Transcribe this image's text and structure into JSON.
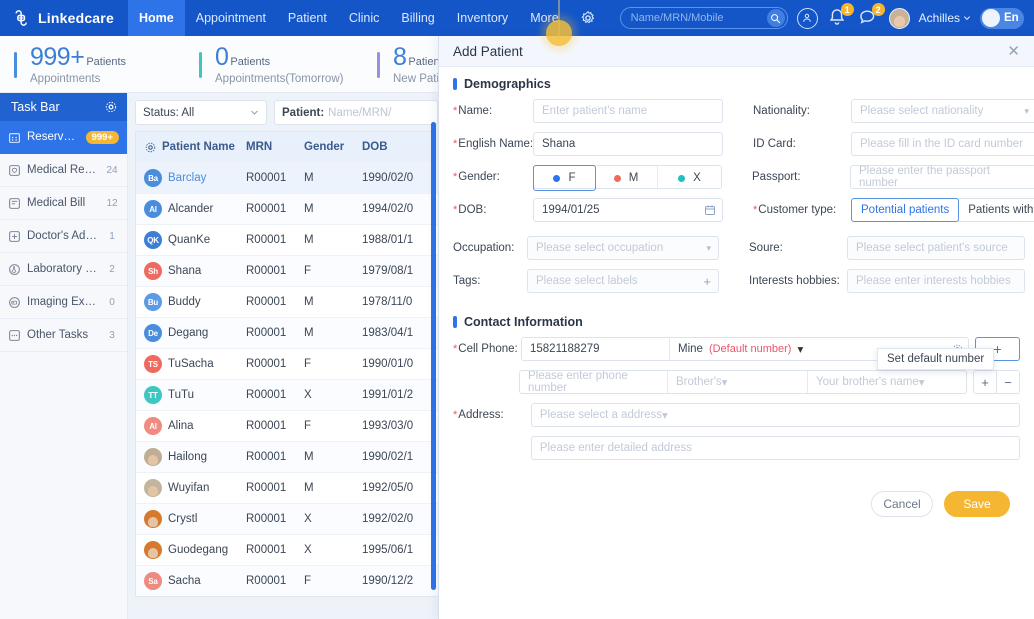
{
  "topnav": {
    "brand": "Linkedcare",
    "items": [
      {
        "label": "Home",
        "active": true
      },
      {
        "label": "Appointment",
        "active": false
      },
      {
        "label": "Patient",
        "active": false
      },
      {
        "label": "Clinic",
        "active": false
      },
      {
        "label": "Billing",
        "active": false
      },
      {
        "label": "Inventory",
        "active": false
      },
      {
        "label": "More",
        "active": false
      }
    ],
    "gear_icon": "gear-icon",
    "search": {
      "placeholder": "Name/MRN/Mobile",
      "value": "",
      "icon": "search-icon"
    },
    "user_add_icon": "user-add-icon",
    "bell": {
      "icon": "bell-icon",
      "badge": "1"
    },
    "chat": {
      "icon": "chat-icon",
      "badge": "2"
    },
    "account": {
      "name": "Achilles",
      "caret": "⌄"
    },
    "language": {
      "label": "En"
    }
  },
  "stats": [
    {
      "number": "999+",
      "unit": "Patients",
      "sub": "Appointments",
      "color": "#4a8ddd"
    },
    {
      "number": "0",
      "unit": "Patients",
      "sub": "Appointments(Tomorrow)",
      "color": "#3ec6c0"
    },
    {
      "number": "8",
      "unit": "Patients",
      "sub": "New Patients",
      "color": "#9a8ede"
    }
  ],
  "sidebar": {
    "title": "Task Bar",
    "gear_icon": "gear-icon",
    "items": [
      {
        "label": "Reservation",
        "count": "999+",
        "pill": true,
        "active": true,
        "icon": "calendar-icon"
      },
      {
        "label": "Medical Record",
        "count": "24",
        "pill": false,
        "active": false,
        "icon": "record-icon"
      },
      {
        "label": "Medical Bill",
        "count": "12",
        "pill": false,
        "active": false,
        "icon": "bill-icon"
      },
      {
        "label": "Doctor's Advice",
        "count": "1",
        "pill": false,
        "active": false,
        "icon": "advice-icon"
      },
      {
        "label": "Laboratory Ex...",
        "count": "2",
        "pill": false,
        "active": false,
        "icon": "lab-icon"
      },
      {
        "label": "Imaging Exam...",
        "count": "0",
        "pill": false,
        "active": false,
        "icon": "imaging-icon"
      },
      {
        "label": "Other Tasks",
        "count": "3",
        "pill": false,
        "active": false,
        "icon": "other-icon"
      }
    ]
  },
  "list": {
    "status_filter": {
      "label": "Status: All"
    },
    "patient_filter": {
      "label": "Patient:",
      "placeholder": "Name/MRN/"
    },
    "columns": [
      "Patient Name",
      "MRN",
      "Gender",
      "DOB"
    ],
    "rows": [
      {
        "initials": "Ba",
        "name": "Barclay",
        "mrn": "R00001",
        "gender": "M",
        "dob": "1990/02/0",
        "color": "#4a8ddd",
        "photo": false,
        "selected": true
      },
      {
        "initials": "Al",
        "name": "Alcander",
        "mrn": "R00001",
        "gender": "M",
        "dob": "1994/02/0",
        "color": "#4a8ddd",
        "photo": false,
        "selected": false
      },
      {
        "initials": "QK",
        "name": "QuanKe",
        "mrn": "R00001",
        "gender": "M",
        "dob": "1988/01/1",
        "color": "#3d7fd6",
        "photo": false,
        "selected": false
      },
      {
        "initials": "Sh",
        "name": "Shana",
        "mrn": "R00001",
        "gender": "F",
        "dob": "1979/08/1",
        "color": "#ef6a5e",
        "photo": false,
        "selected": false
      },
      {
        "initials": "Bu",
        "name": "Buddy",
        "mrn": "R00001",
        "gender": "M",
        "dob": "1978/11/0",
        "color": "#5b9ae6",
        "photo": false,
        "selected": false
      },
      {
        "initials": "De",
        "name": "Degang",
        "mrn": "R00001",
        "gender": "M",
        "dob": "1983/04/1",
        "color": "#4a8ddd",
        "photo": false,
        "selected": false
      },
      {
        "initials": "TS",
        "name": "TuSacha",
        "mrn": "R00001",
        "gender": "F",
        "dob": "1990/01/0",
        "color": "#ef6a5e",
        "photo": false,
        "selected": false
      },
      {
        "initials": "TT",
        "name": "TuTu",
        "mrn": "R00001",
        "gender": "X",
        "dob": "1991/01/2",
        "color": "#3ec6c0",
        "photo": false,
        "selected": false
      },
      {
        "initials": "Al",
        "name": "Alina",
        "mrn": "R00001",
        "gender": "F",
        "dob": "1993/03/0",
        "color": "#f08b82",
        "photo": false,
        "selected": false
      },
      {
        "initials": "",
        "name": "Hailong",
        "mrn": "R00001",
        "gender": "M",
        "dob": "1990/02/1",
        "color": "#c9b49b",
        "photo": true,
        "selected": false
      },
      {
        "initials": "",
        "name": "Wuyifan",
        "mrn": "R00001",
        "gender": "M",
        "dob": "1992/05/0",
        "color": "#c9b49b",
        "photo": true,
        "selected": false
      },
      {
        "initials": "",
        "name": "Crystl",
        "mrn": "R00001",
        "gender": "X",
        "dob": "1992/02/0",
        "color": "#d6792e",
        "photo": true,
        "selected": false
      },
      {
        "initials": "",
        "name": "Guodegang",
        "mrn": "R00001",
        "gender": "X",
        "dob": "1995/06/1",
        "color": "#d6792e",
        "photo": true,
        "selected": false
      },
      {
        "initials": "Sa",
        "name": "Sacha",
        "mrn": "R00001",
        "gender": "F",
        "dob": "1990/12/2",
        "color": "#ef8a80",
        "photo": false,
        "selected": false
      }
    ]
  },
  "panel": {
    "title": "Add Patient",
    "close_icon": "close-icon",
    "sections": {
      "demographics": "Demographics",
      "contact": "Contact Information"
    },
    "fields": {
      "name": {
        "label": "Name:",
        "placeholder": "Enter patient's name",
        "value": ""
      },
      "english_name": {
        "label": "English Name:",
        "placeholder": "",
        "value": "Shana"
      },
      "gender": {
        "label": "Gender:",
        "options": [
          {
            "label": "F",
            "color": "#2f73e8",
            "selected": true
          },
          {
            "label": "M",
            "color": "#ef6a5e",
            "selected": false
          },
          {
            "label": "X",
            "color": "#20c0bc",
            "selected": false
          }
        ]
      },
      "dob": {
        "label": "DOB:",
        "value": "1994/01/25",
        "icon": "calendar-icon"
      },
      "occupation": {
        "label": "Occupation:",
        "placeholder": "Please select occupation"
      },
      "tags": {
        "label": "Tags:",
        "placeholder": "Please select labels",
        "icon": "plus-icon"
      },
      "nationality": {
        "label": "Nationality:",
        "placeholder": "Please select nationality"
      },
      "id_card": {
        "label": "ID Card:",
        "placeholder": "Please fill in the ID card number"
      },
      "passport": {
        "label": "Passport:",
        "placeholder": "Please enter the passport number"
      },
      "customer_type": {
        "label": "Customer type:",
        "options": [
          {
            "label": "Potential patients",
            "selected": true
          },
          {
            "label": "Patients with formal",
            "selected": false
          }
        ]
      },
      "source": {
        "label": "Soure:",
        "placeholder": "Please select patient's source"
      },
      "interests": {
        "label": "Interests hobbies:",
        "placeholder": "Please enter interests hobbies"
      },
      "cell_phone": {
        "label": "Cell Phone:",
        "value": "15821188279",
        "relation": "Mine",
        "default_note": "(Default number)",
        "gear_icon": "gear-icon",
        "add_label": "+"
      },
      "sub_phone": {
        "placeholder": "Please enter phone number",
        "relation_placeholder": "Brother's",
        "name_placeholder": "Your brother's name",
        "add_label": "+",
        "remove_label": "−"
      },
      "address": {
        "label": "Address:",
        "placeholder": "Please select a address"
      },
      "detailed_address": {
        "placeholder": "Please enter detailed address"
      }
    },
    "tooltip": "Set default number",
    "buttons": {
      "cancel": "Cancel",
      "save": "Save"
    }
  }
}
